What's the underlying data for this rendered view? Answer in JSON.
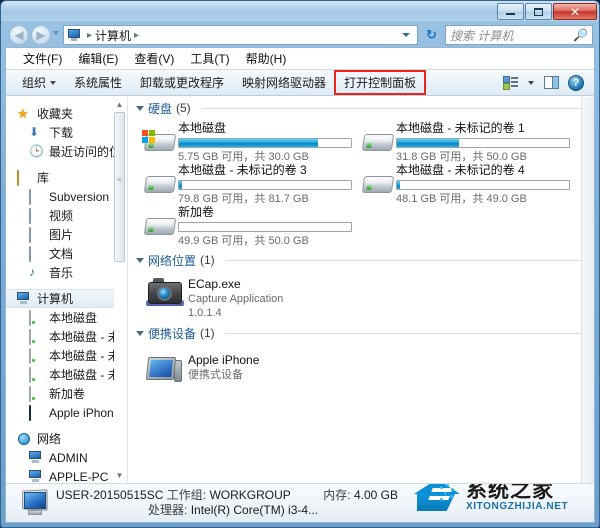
{
  "window": {
    "controls": {
      "minimize": "–",
      "maximize": "□",
      "close": "✕"
    }
  },
  "addressbar": {
    "back_icon": "◀",
    "forward_icon": "▶",
    "breadcrumb_icon": "computer-icon",
    "breadcrumb": "计算机",
    "separator": "▸",
    "refresh_icon": "↻",
    "search_placeholder": "搜索 计算机",
    "search_value": "",
    "search_icon": "search-icon"
  },
  "menubar": {
    "items": [
      {
        "label": "文件(F)"
      },
      {
        "label": "编辑(E)"
      },
      {
        "label": "查看(V)"
      },
      {
        "label": "工具(T)"
      },
      {
        "label": "帮助(H)"
      }
    ]
  },
  "toolbar": {
    "organize": "组织",
    "items": [
      {
        "label": "系统属性",
        "highlight": false
      },
      {
        "label": "卸载或更改程序",
        "highlight": false
      },
      {
        "label": "映射网络驱动器",
        "highlight": false
      },
      {
        "label": "打开控制面板",
        "highlight": true
      }
    ],
    "highlight_color": "#e8261b",
    "help_glyph": "?"
  },
  "sidebar": {
    "groups": [
      {
        "header": {
          "label": "收藏夹",
          "icon": "star-icon"
        },
        "items": [
          {
            "label": "下载",
            "icon": "download-icon"
          },
          {
            "label": "最近访问的位置",
            "icon": "recent-places-icon"
          }
        ]
      },
      {
        "header": {
          "label": "库",
          "icon": "library-icon"
        },
        "items": [
          {
            "label": "Subversion",
            "icon": "folder-icon"
          },
          {
            "label": "视频",
            "icon": "video-icon"
          },
          {
            "label": "图片",
            "icon": "pictures-icon"
          },
          {
            "label": "文档",
            "icon": "documents-icon"
          },
          {
            "label": "音乐",
            "icon": "music-icon"
          }
        ]
      },
      {
        "header": {
          "label": "计算机",
          "icon": "computer-icon",
          "selected": true
        },
        "items": [
          {
            "label": "本地磁盘",
            "icon": "system-drive-icon"
          },
          {
            "label": "本地磁盘 - 未标i",
            "icon": "drive-icon"
          },
          {
            "label": "本地磁盘 - 未标i",
            "icon": "drive-icon"
          },
          {
            "label": "本地磁盘 - 未标i",
            "icon": "drive-icon"
          },
          {
            "label": "新加卷",
            "icon": "drive-icon"
          },
          {
            "label": "Apple iPhone",
            "icon": "phone-icon"
          }
        ]
      },
      {
        "header": {
          "label": "网络",
          "icon": "network-icon"
        },
        "items": [
          {
            "label": "ADMIN",
            "icon": "computer-icon"
          },
          {
            "label": "APPLE-PC",
            "icon": "computer-icon"
          }
        ]
      }
    ],
    "scroll_up": "▲",
    "scroll_down": "▼"
  },
  "content": {
    "sections": [
      {
        "title": "硬盘",
        "count": "(5)"
      },
      {
        "title": "网络位置",
        "count": "(1)"
      },
      {
        "title": "便携设备",
        "count": "(1)"
      }
    ],
    "drives": [
      {
        "name": "本地磁盘",
        "free": "5.75 GB",
        "total": "30.0 GB",
        "sub": "5.75 GB 可用，共 30.0 GB",
        "used_pct": 81,
        "system": true
      },
      {
        "name": "本地磁盘 - 未标记的卷 1",
        "free": "31.8 GB",
        "total": "50.0 GB",
        "sub": "31.8 GB 可用，共 50.0 GB",
        "used_pct": 36,
        "system": false
      },
      {
        "name": "本地磁盘 - 未标记的卷 3",
        "free": "79.8 GB",
        "total": "81.7 GB",
        "sub": "79.8 GB 可用，共 81.7 GB",
        "used_pct": 2,
        "system": false
      },
      {
        "name": "本地磁盘 - 未标记的卷 4",
        "free": "48.1 GB",
        "total": "49.0 GB",
        "sub": "48.1 GB 可用，共 49.0 GB",
        "used_pct": 2,
        "system": false
      },
      {
        "name": "新加卷",
        "free": "49.9 GB",
        "total": "50.0 GB",
        "sub": "49.9 GB 可用，共 50.0 GB",
        "used_pct": 0,
        "system": false
      }
    ],
    "network_location": {
      "name": "ECap.exe",
      "description": "Capture Application",
      "version": "1.0.1.4",
      "icon": "camera-icon"
    },
    "portable_device": {
      "name": "Apple iPhone",
      "description": "便携式设备",
      "icon": "iphone-icon"
    },
    "bar_color": "#1aa8dc"
  },
  "statusbar": {
    "computer_name": "USER-20150515SC",
    "workgroup_label": "工作组:",
    "workgroup_value": "WORKGROUP",
    "memory_label": "内存:",
    "memory_value": "4.00 GB",
    "processor_label": "处理器:",
    "processor_value": "Intel(R) Core(TM) i3-4...",
    "icon": "computer-icon"
  },
  "watermark": {
    "chinese": "系统之家",
    "english": "XITONGZHIJIA.NET",
    "color": "#1b6fa8"
  }
}
